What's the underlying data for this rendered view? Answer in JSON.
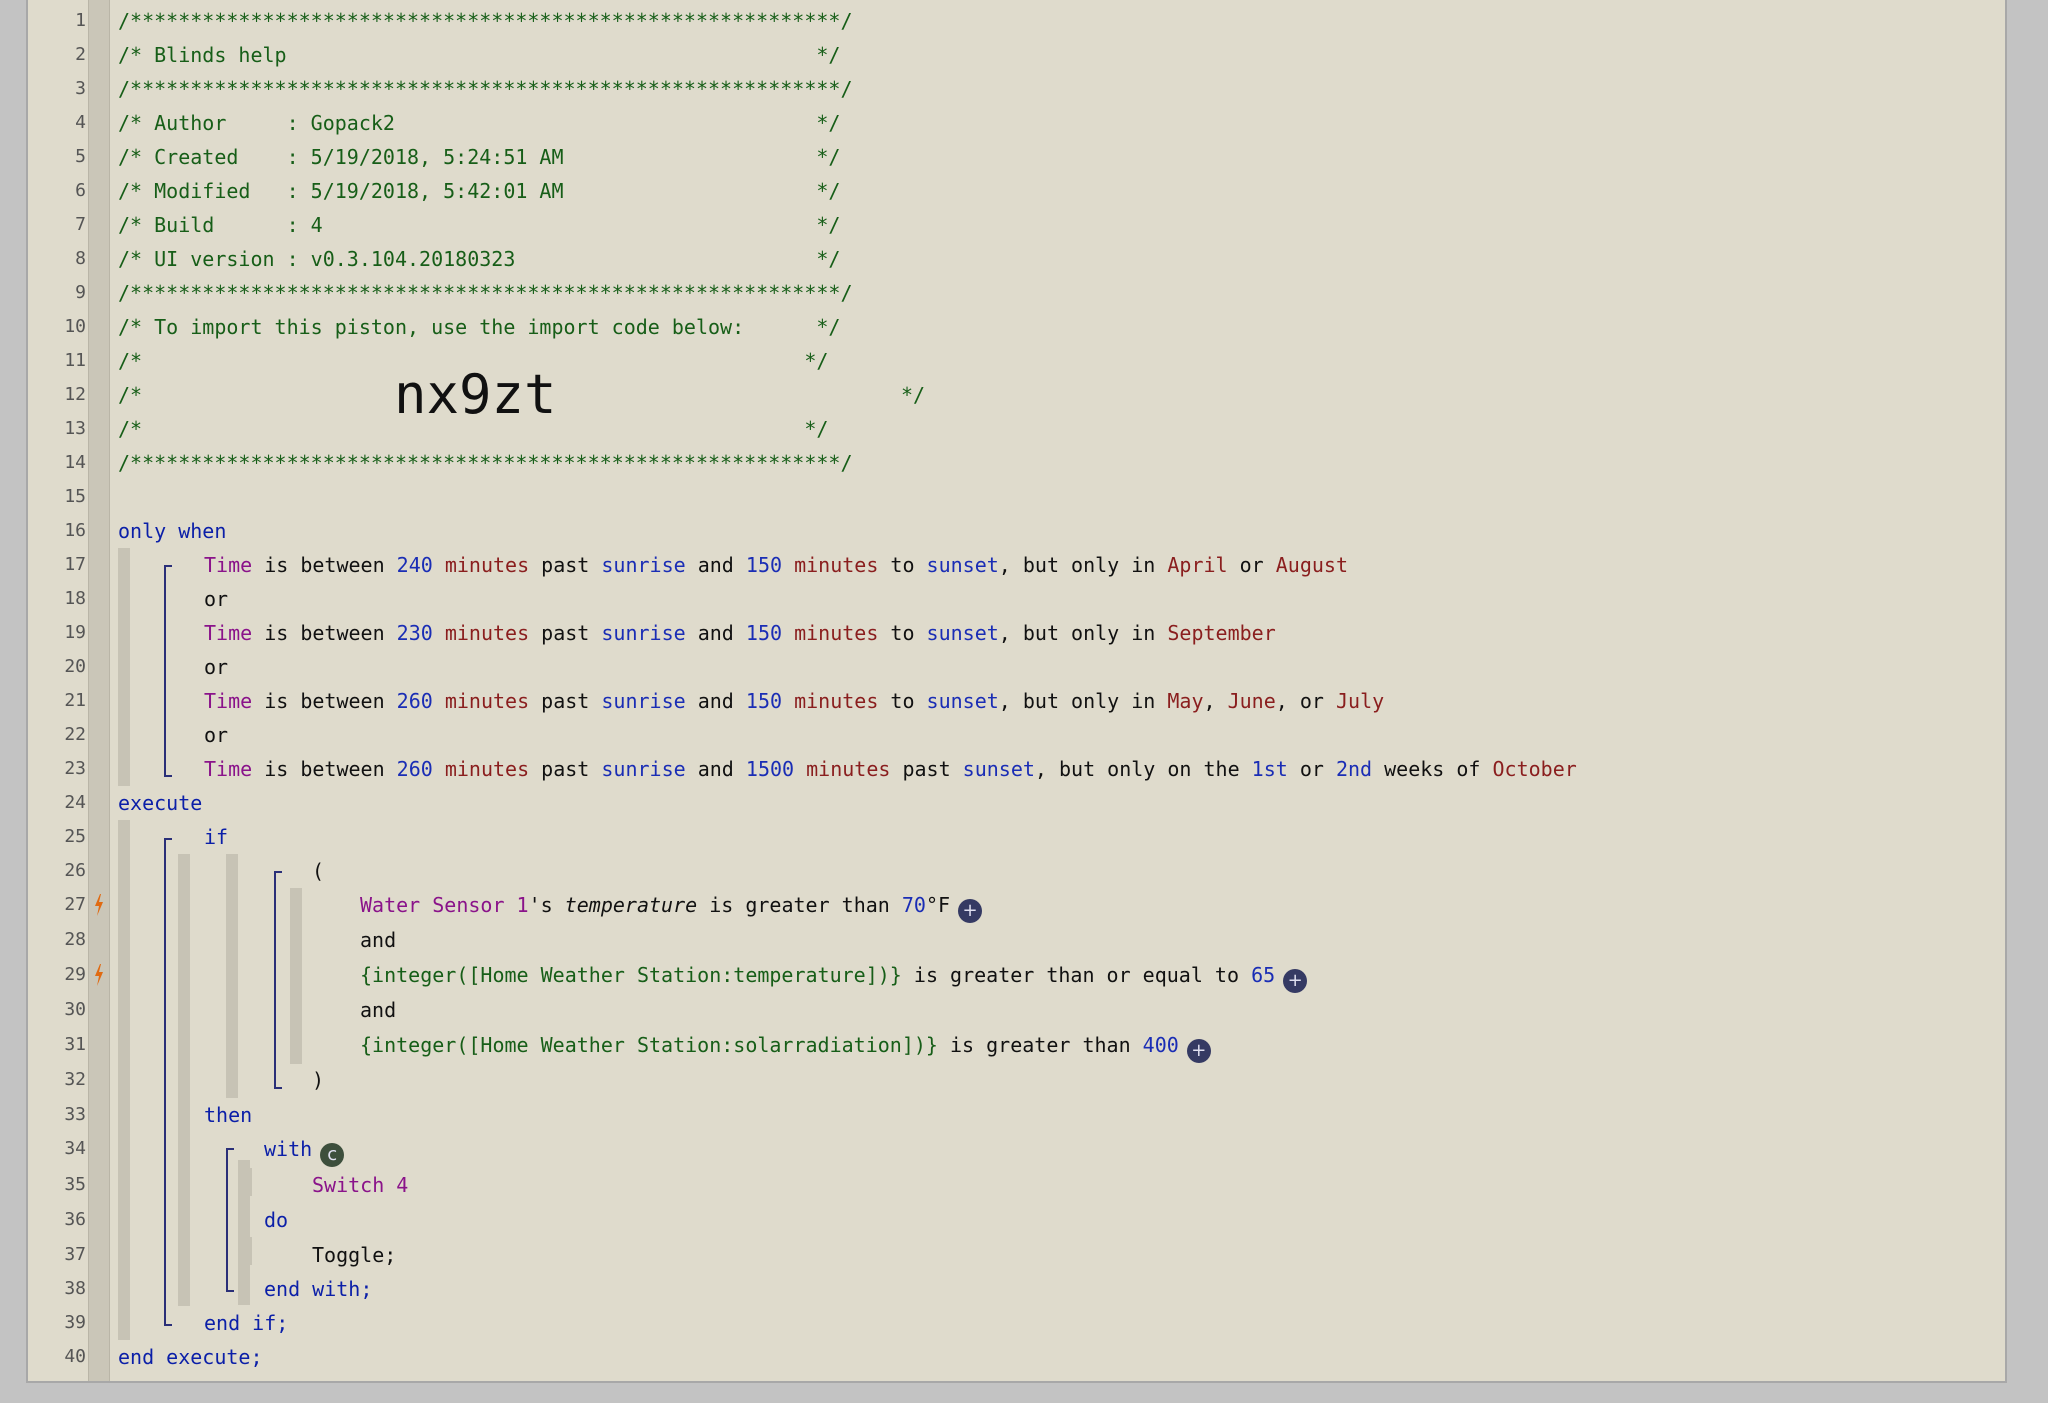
{
  "editor": {
    "lines": [
      {
        "n": "1",
        "t": "/***********************************************************/",
        "cls": "c"
      },
      {
        "n": "2",
        "t": "/* Blinds help                                            */",
        "cls": "c"
      },
      {
        "n": "3",
        "t": "/***********************************************************/",
        "cls": "c"
      },
      {
        "n": "4",
        "t": "/* Author     : Gopack2                                   */",
        "cls": "c"
      },
      {
        "n": "5",
        "t": "/* Created    : 5/19/2018, 5:24:51 AM                     */",
        "cls": "c"
      },
      {
        "n": "6",
        "t": "/* Modified   : 5/19/2018, 5:42:01 AM                     */",
        "cls": "c"
      },
      {
        "n": "7",
        "t": "/* Build      : 4                                         */",
        "cls": "c"
      },
      {
        "n": "8",
        "t": "/* UI version : v0.3.104.20180323                         */",
        "cls": "c"
      },
      {
        "n": "9",
        "t": "/***********************************************************/",
        "cls": "c"
      },
      {
        "n": "10",
        "t": "/* To import this piston, use the import code below:      */",
        "cls": "c"
      },
      {
        "n": "11",
        "t": "/*                                                       */",
        "cls": "c"
      },
      {
        "n": "12a",
        "t": "/*",
        "cls": "c"
      },
      {
        "n": "12b",
        "t": "*/",
        "cls": "c"
      },
      {
        "n": "13",
        "t": "/*                                                       */",
        "cls": "c"
      },
      {
        "n": "14",
        "t": "/***********************************************************/",
        "cls": "c"
      }
    ],
    "import_code": "nx9zt",
    "line_numbers": [
      "1",
      "2",
      "3",
      "4",
      "5",
      "6",
      "7",
      "8",
      "9",
      "10",
      "11",
      "12",
      "13",
      "14",
      "15",
      "16",
      "17",
      "18",
      "19",
      "20",
      "21",
      "22",
      "23",
      "24",
      "25",
      "26",
      "27",
      "28",
      "29",
      "30",
      "31",
      "32",
      "33",
      "34",
      "35",
      "36",
      "37",
      "38",
      "39",
      "40"
    ],
    "kw": {
      "only_when": "only when",
      "or": "or",
      "execute": "execute",
      "if": "if",
      "open_paren": "(",
      "close_paren": ")",
      "and": "and",
      "then": "then",
      "with": "with",
      "do": "do",
      "end_with": "end with;",
      "end_if": "end if;",
      "end_execute": "end execute;"
    },
    "conditions": {
      "c1": {
        "var": "Time",
        "a": " is between ",
        "n1": "240",
        "u1": "minutes",
        "b": " past ",
        "s1": "sunrise",
        "c": " and ",
        "n2": "150",
        "u2": "minutes",
        "d": " to ",
        "s2": "sunset",
        "e": ", but only in ",
        "m1": "April",
        "f": " or ",
        "m2": "August"
      },
      "c2": {
        "var": "Time",
        "a": " is between ",
        "n1": "230",
        "u1": "minutes",
        "b": " past ",
        "s1": "sunrise",
        "c": " and ",
        "n2": "150",
        "u2": "minutes",
        "d": " to ",
        "s2": "sunset",
        "e": ", but only in ",
        "m1": "September"
      },
      "c3": {
        "var": "Time",
        "a": " is between ",
        "n1": "260",
        "u1": "minutes",
        "b": " past ",
        "s1": "sunrise",
        "c": " and ",
        "n2": "150",
        "u2": "minutes",
        "d": " to ",
        "s2": "sunset",
        "e": ", but only in ",
        "m1": "May",
        "f": ", ",
        "m2": "June",
        "g": ", or ",
        "m3": "July"
      },
      "c4": {
        "var": "Time",
        "a": " is between ",
        "n1": "260",
        "u1": "minutes",
        "b": " past ",
        "s1": "sunrise",
        "c": " and ",
        "n2": "1500",
        "u2": "minutes",
        "d": " past ",
        "s2": "sunset",
        "e": ", but only on the ",
        "w1": "1st",
        "f": " or ",
        "w2": "2nd",
        "g": " weeks of ",
        "m1": "October"
      }
    },
    "if_conditions": {
      "d1": {
        "dev": "Water Sensor 1",
        "pos": "'s ",
        "attr": "temperature",
        "op": " is greater than ",
        "val": "70",
        "unit": "°F"
      },
      "d2": {
        "expr": "{integer([Home Weather Station:temperature])}",
        "op": " is greater than or equal to ",
        "val": "65"
      },
      "d3": {
        "expr": "{integer([Home Weather Station:solarradiation])}",
        "op": " is greater than ",
        "val": "400"
      }
    },
    "with_device": "Switch 4",
    "command": "Toggle;",
    "icons": {
      "plus": "+",
      "c_badge": "c",
      "trigger_icon": "lightning-bolt-icon"
    },
    "colors": {
      "background": "#dfdbcc",
      "keyword": "#0b1fa8",
      "variable": "#8a138a",
      "number": "#1a2db5",
      "unit": "#8a1e1e",
      "comment": "#175e18",
      "trigger": "#e06a12"
    }
  }
}
